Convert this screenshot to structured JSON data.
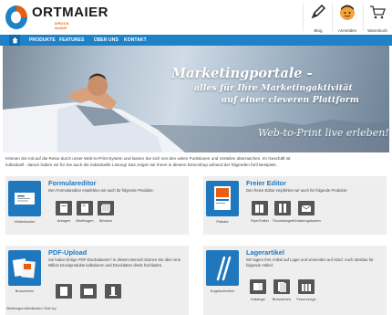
{
  "brand": {
    "name": "ORTMAIER",
    "sub": "DRUCK GmbH",
    "colors": {
      "orange": "#e85d10",
      "blue": "#1f82c6",
      "dark": "#1a1a1a"
    }
  },
  "header": {
    "buttons": [
      {
        "label": "Blog",
        "icon": "pen-icon"
      },
      {
        "label": "Anmelden",
        "icon": "avatar-icon"
      },
      {
        "label": "Warenkorb",
        "icon": "cart-icon"
      }
    ]
  },
  "nav": {
    "home_icon": "home-icon",
    "items": [
      "PRODUKTE",
      "FEATURES",
      "ÜBER UNS",
      "KONTAKT"
    ]
  },
  "banner": {
    "headline": "Marketingportale -",
    "line2": "alles für Ihre Marketingaktivität",
    "line3": "auf einer cleveren Plattform",
    "script": "Web-to-Print live erleben!"
  },
  "intro": {
    "line1": "Können Sie mit auf die Reise durch unser Web-to-Print-System und lassen Sie sich von den vielen Funktionen und Vorteilen überraschen. Im Geschäft ist",
    "line2": "individuell - darum haben wir für Sie auch die individuelle Lösung! Das zeigen wir Ihnen in diesem Demoshop anhand der folgenden fünf Beispiele."
  },
  "cards": [
    {
      "title": "Formulareditor",
      "desc": "Den Formulareditor empfehlen wir auch für folgende Produkte:",
      "thumb_caption": "Visitenkarten",
      "options": [
        "Anlagen",
        "Briefbogen",
        "Blöcken"
      ]
    },
    {
      "title": "Freier Editor",
      "desc": "Den freien Editor empfehlen wir auch für folgende Produkte:",
      "thumb_caption": "Plakate",
      "options": [
        "Flyer/Falter",
        "Türanhänger",
        "Einladungskarten"
      ]
    },
    {
      "title": "PDF-Upload",
      "desc": "Sie haben fertige PDF-Druckdateien? In diesem Bereich können Sie über eine Million Druckprodukte kalkulieren und Druckdaten direkt hochladen.",
      "thumb_caption": "Broschüren",
      "extra_captions": [
        "Briefbogen",
        "Briefkarten",
        "Roll-Up"
      ],
      "options": []
    },
    {
      "title": "Lagerartikel",
      "desc": "Wir lagern Ihre Artikel auf Lager und versenden auf Abruf. Auch denkbar für folgende Artikel:",
      "thumb_caption": "Kugelschreiber",
      "options": [
        "Kataloge",
        "Broschüren",
        "Feuerzeuge"
      ]
    }
  ]
}
